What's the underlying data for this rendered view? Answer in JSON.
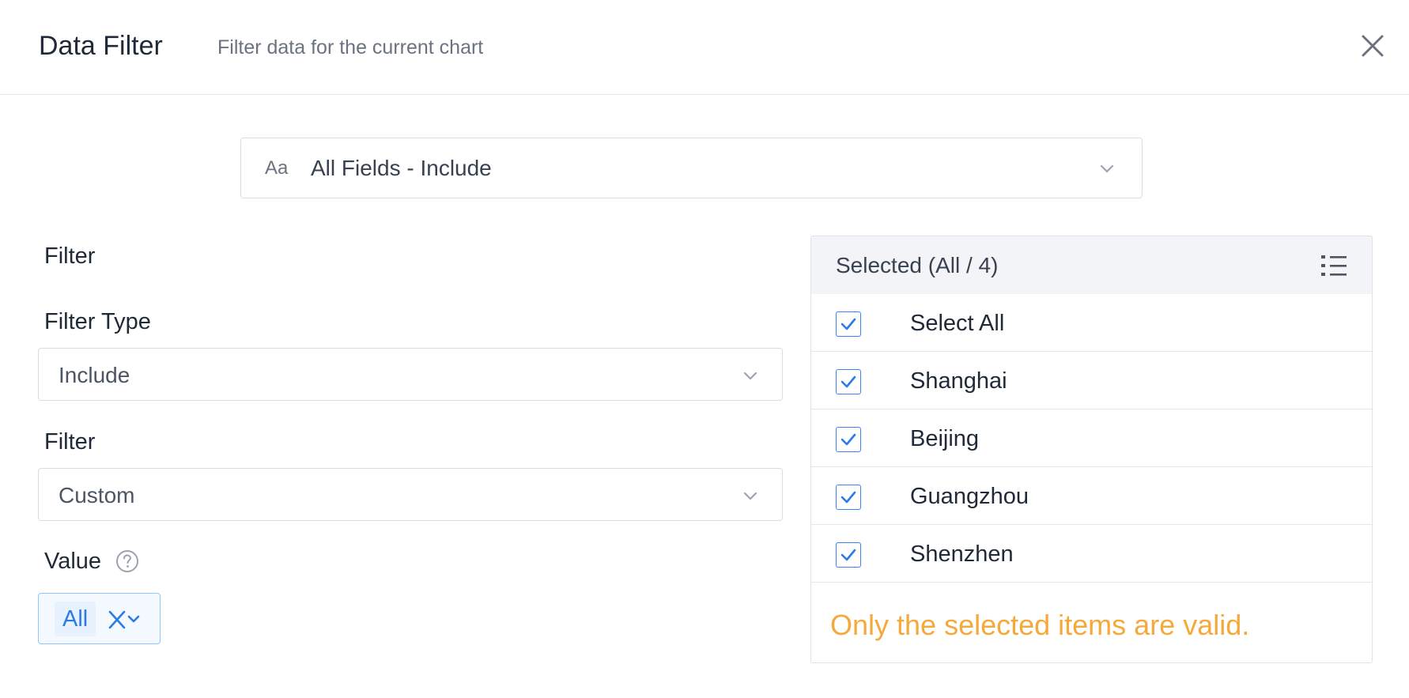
{
  "header": {
    "title": "Data Filter",
    "subtitle": "Filter data for the current chart"
  },
  "field_select": {
    "type_icon_text": "Aa",
    "value": "All Fields - Include"
  },
  "form": {
    "section_label": "Filter",
    "filter_type_label": "Filter Type",
    "filter_type_value": "Include",
    "filter_label": "Filter",
    "filter_value": "Custom",
    "value_label": "Value",
    "value_tag": "All"
  },
  "selected_panel": {
    "title": "Selected (All / 4)",
    "items": [
      {
        "label": "Select All",
        "checked": true
      },
      {
        "label": "Shanghai",
        "checked": true
      },
      {
        "label": "Beijing",
        "checked": true
      },
      {
        "label": "Guangzhou",
        "checked": true
      },
      {
        "label": "Shenzhen",
        "checked": true
      }
    ],
    "note": "Only the selected items are valid."
  },
  "icons": {
    "close": "close-icon",
    "chevron": "chevron-down-icon",
    "help": "help-circle-icon",
    "list": "list-icon",
    "check": "check-icon"
  },
  "colors": {
    "accent": "#3b82f6",
    "tag_text": "#2b7ae6",
    "warning": "#f5a93b",
    "panel_header_bg": "#f3f4f7"
  }
}
